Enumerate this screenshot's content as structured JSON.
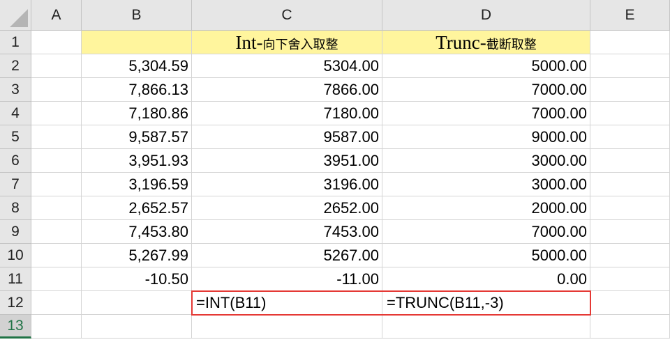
{
  "columns": [
    "A",
    "B",
    "C",
    "D",
    "E"
  ],
  "rows": [
    "1",
    "2",
    "3",
    "4",
    "5",
    "6",
    "7",
    "8",
    "9",
    "10",
    "11",
    "12",
    "13"
  ],
  "headers": {
    "c_title_main": "Int-",
    "c_title_sub": "向下舍入取整",
    "d_title_main": "Trunc-",
    "d_title_sub": "截断取整"
  },
  "data": [
    {
      "b": "5,304.59",
      "c": "5304.00",
      "d": "5000.00"
    },
    {
      "b": "7,866.13",
      "c": "7866.00",
      "d": "7000.00"
    },
    {
      "b": "7,180.86",
      "c": "7180.00",
      "d": "7000.00"
    },
    {
      "b": "9,587.57",
      "c": "9587.00",
      "d": "9000.00"
    },
    {
      "b": "3,951.93",
      "c": "3951.00",
      "d": "3000.00"
    },
    {
      "b": "3,196.59",
      "c": "3196.00",
      "d": "3000.00"
    },
    {
      "b": "2,652.57",
      "c": "2652.00",
      "d": "2000.00"
    },
    {
      "b": "7,453.80",
      "c": "7453.00",
      "d": "7000.00"
    },
    {
      "b": "5,267.99",
      "c": "5267.00",
      "d": "5000.00"
    },
    {
      "b": "-10.50",
      "c": "-11.00",
      "d": "0.00"
    }
  ],
  "formulas": {
    "c12": "=INT(B11)",
    "d12": "=TRUNC(B11,-3)"
  },
  "colors": {
    "header_bg": "#e6e6e6",
    "yellow_fill": "#fff59d",
    "highlight_border": "#e53935",
    "active_row": "#217346"
  }
}
